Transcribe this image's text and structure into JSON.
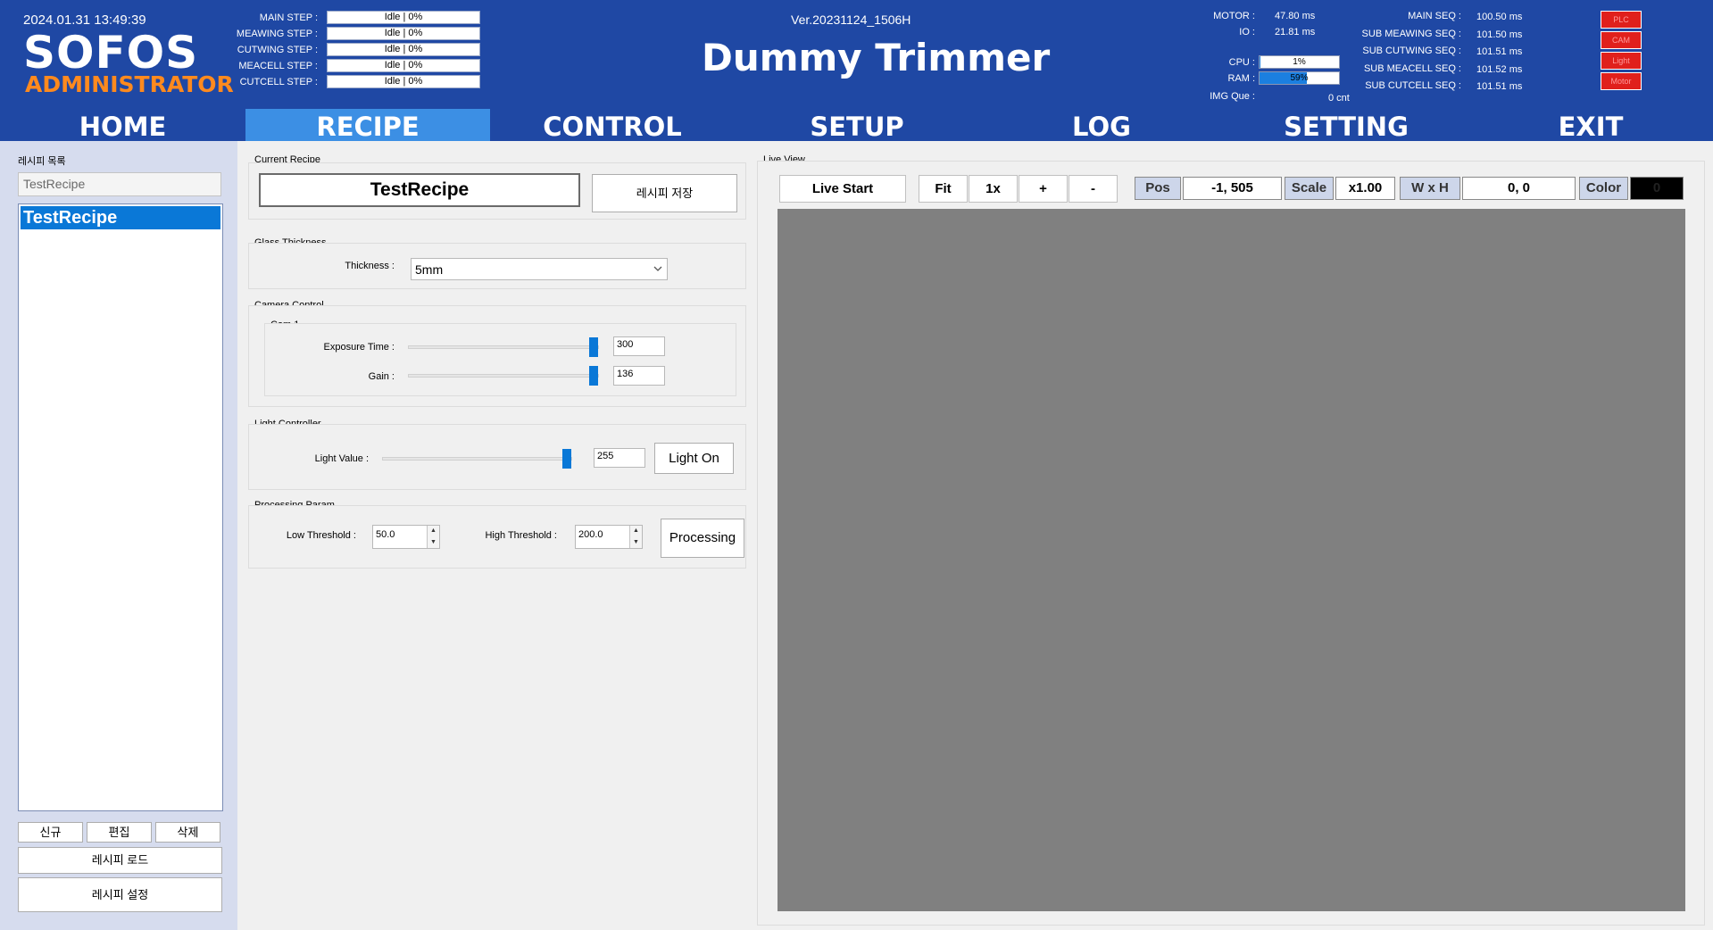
{
  "header": {
    "datetime": "2024.01.31 13:49:39",
    "logo": "SOFOS",
    "role": "ADMINISTRATOR",
    "version": "Ver.20231124_1506H",
    "title": "Dummy Trimmer",
    "steps": [
      {
        "label": "MAIN STEP :",
        "value": "Idle | 0%"
      },
      {
        "label": "MEAWING STEP :",
        "value": "Idle | 0%"
      },
      {
        "label": "CUTWING STEP :",
        "value": "Idle | 0%"
      },
      {
        "label": "MEACELL STEP :",
        "value": "Idle | 0%"
      },
      {
        "label": "CUTCELL STEP :",
        "value": "Idle | 0%"
      }
    ],
    "timing": {
      "motor_label": "MOTOR :",
      "motor_value": "47.80 ms",
      "io_label": "IO :",
      "io_value": "21.81 ms",
      "cpu_label": "CPU :",
      "cpu_value": "1%",
      "cpu_fraction": 0.01,
      "ram_label": "RAM :",
      "ram_value": "59%",
      "ram_fraction": 0.59,
      "img_que_label": "IMG Que :",
      "img_que_value": "0 cnt"
    },
    "sequences": [
      {
        "label": "MAIN SEQ :",
        "value": "100.50 ms"
      },
      {
        "label": "SUB MEAWING SEQ :",
        "value": "101.50 ms"
      },
      {
        "label": "SUB CUTWING SEQ :",
        "value": "101.51 ms"
      },
      {
        "label": "SUB MEACELL SEQ :",
        "value": "101.52 ms"
      },
      {
        "label": "SUB CUTCELL SEQ :",
        "value": "101.51 ms"
      }
    ],
    "indicators": [
      {
        "label": "PLC",
        "color": "#e0201c"
      },
      {
        "label": "CAM",
        "color": "#e0201c"
      },
      {
        "label": "Light",
        "color": "#e0201c"
      },
      {
        "label": "Motor",
        "color": "#e0201c"
      }
    ]
  },
  "nav": [
    {
      "label": "HOME"
    },
    {
      "label": "RECIPE",
      "active": true
    },
    {
      "label": "CONTROL"
    },
    {
      "label": "SETUP"
    },
    {
      "label": "LOG"
    },
    {
      "label": "SETTING"
    },
    {
      "label": "EXIT"
    }
  ],
  "left": {
    "title": "레시피 목록",
    "search_value": "TestRecipe",
    "items": [
      "TestRecipe"
    ],
    "new_label": "신규",
    "edit_label": "편집",
    "delete_label": "삭제",
    "load_label": "레시피 로드",
    "settings_label": "레시피 설정"
  },
  "recipe": {
    "current_title": "Current Recipe",
    "current_name": "TestRecipe",
    "save_label": "레시피 저장",
    "glass": {
      "title": "Glass Thickness",
      "thickness_label": "Thickness :",
      "thickness_value": "5mm"
    },
    "camera": {
      "title": "Camera Control",
      "cam_title": "Cam 1",
      "exposure_label": "Exposure Time :",
      "exposure_value": "300",
      "gain_label": "Gain :",
      "gain_value": "136"
    },
    "light": {
      "title": "Light Controller",
      "value_label": "Light Value :",
      "value": "255",
      "on_label": "Light On"
    },
    "processing": {
      "title": "Processing Param",
      "low_label": "Low Threshold :",
      "low_value": "50.0",
      "high_label": "High Threshold :",
      "high_value": "200.0",
      "button_label": "Processing"
    }
  },
  "live": {
    "title": "Live View",
    "start_label": "Live Start",
    "fit_label": "Fit",
    "onex_label": "1x",
    "zoom_in_label": "+",
    "zoom_out_label": "-",
    "pos_label": "Pos",
    "pos_value": "-1,  505",
    "scale_label": "Scale",
    "scale_value": "x1.00",
    "wh_label": "W x H",
    "wh_value": "0,    0",
    "color_label": "Color",
    "color_value": "0",
    "viewport_color": "#808080"
  }
}
